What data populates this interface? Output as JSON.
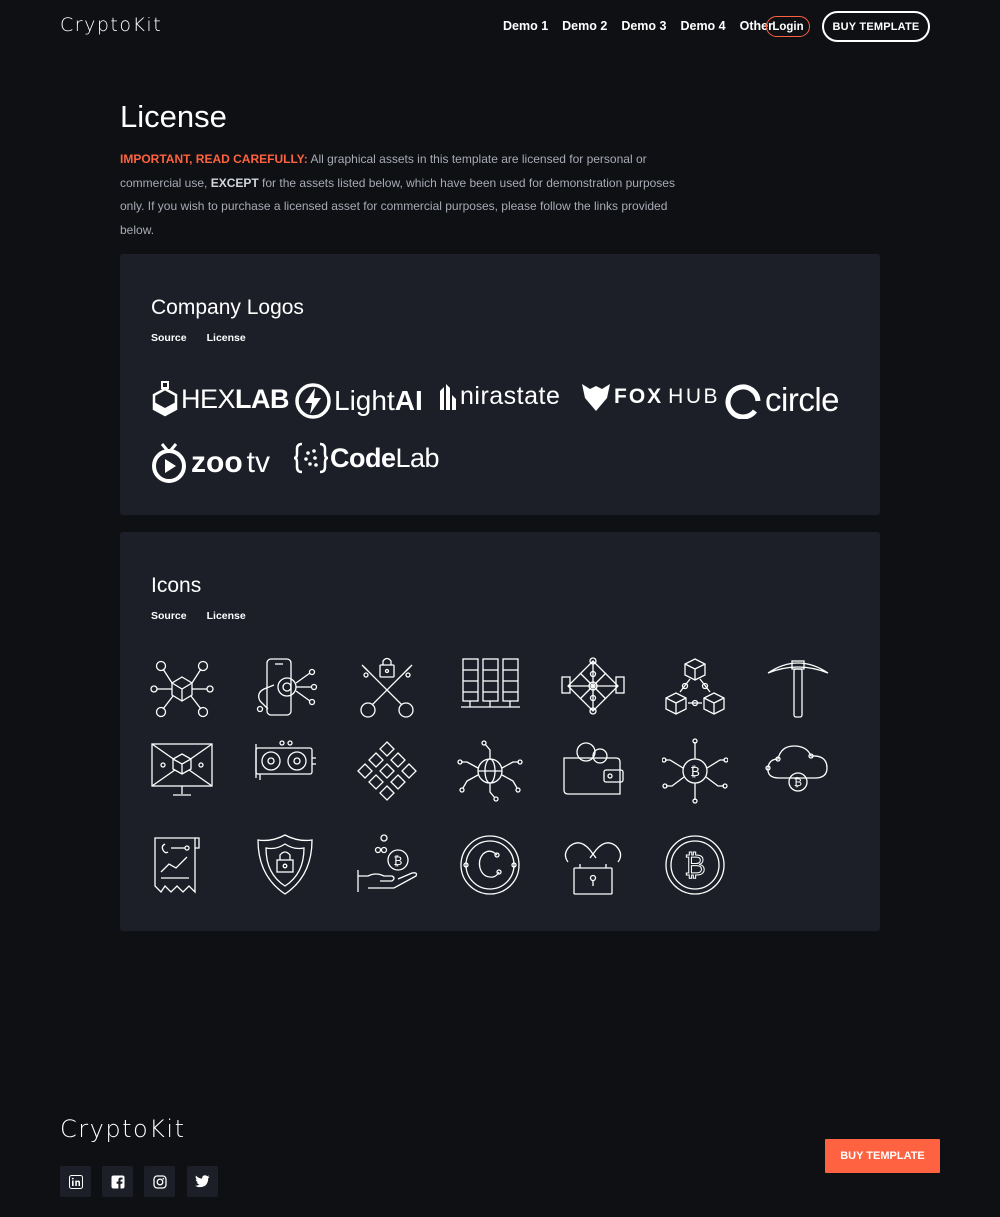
{
  "header": {
    "brand": "CryptoKit",
    "nav": [
      "Demo 1",
      "Demo 2",
      "Demo 3",
      "Demo 4",
      "Other"
    ],
    "login": "Login",
    "buy": "BUY TEMPLATE"
  },
  "license": {
    "title": "License",
    "important": "IMPORTANT, READ CAREFULLY:",
    "text_1": " All graphical assets in this template are licensed for personal or commercial use, ",
    "except": "EXCEPT",
    "text_2": " for the assets listed below, which have been used for demonstration purposes only. If you wish to purchase a licensed asset  for commercial purposes, please follow the  links provided below."
  },
  "logos_panel": {
    "title": "Company Logos",
    "source": "Source",
    "license": "License",
    "logos": {
      "hexlab_a": "HEX",
      "hexlab_b": "LAB",
      "lightai_a": "Light",
      "lightai_b": "AI",
      "nirastate": "nirastate",
      "foxhub_a": "FOX",
      "foxhub_b": "HUB",
      "circle": "circle",
      "zootv_a": "zoo",
      "zootv_b": "tv",
      "codelab_a": "Code",
      "codelab_b": "Lab"
    }
  },
  "icons_panel": {
    "title": "Icons",
    "source": "Source",
    "license": "License",
    "icons": [
      "blockchain-network-icon",
      "mobile-network-icon",
      "crossed-keys-icon",
      "server-racks-icon",
      "node-network-icon",
      "linked-blocks-icon",
      "pickaxe-icon",
      "monitor-blocks-icon",
      "graphics-card-icon",
      "diamond-grid-icon",
      "globe-circuit-icon",
      "crypto-wallet-icon",
      "bitcoin-circuit-icon",
      "bitcoin-cloud-icon",
      "receipt-chart-icon",
      "security-shield-icon",
      "bitcoin-hand-icon",
      "coin-circuit-icon",
      "padlock-chain-icon",
      "bitcoin-coin-icon"
    ]
  },
  "footer": {
    "brand": "CryptoKit",
    "social": [
      "linkedin-icon",
      "facebook-icon",
      "instagram-icon",
      "twitter-icon"
    ],
    "buy": "BUY TEMPLATE"
  },
  "colors": {
    "accent": "#ff6240",
    "background": "#0e1014",
    "panel": "#1c1f27",
    "text_muted": "#a7abb4"
  }
}
